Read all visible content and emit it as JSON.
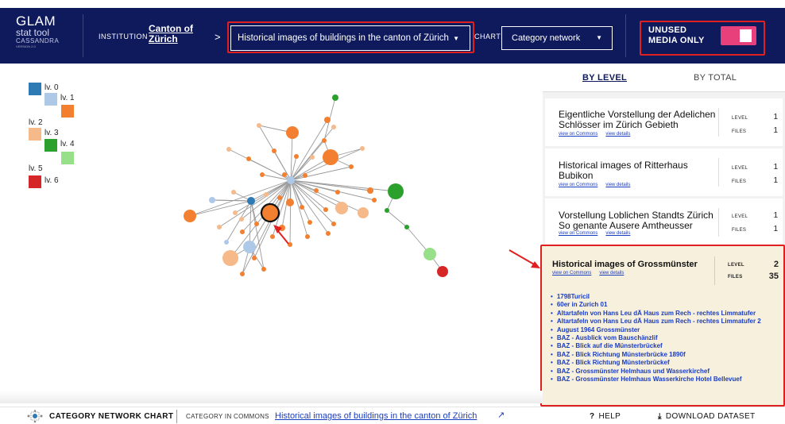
{
  "header": {
    "logo": {
      "line1": "GLAM",
      "line2": "stat tool",
      "line3": "CASSANDRA",
      "line4": "VERSION 2.0"
    },
    "institution_label": "INSTITUTION",
    "institution_value": "Canton of Zürich",
    "separator": ">",
    "dataset_selected": "Historical images of buildings in the canton of Zürich",
    "chart_label": "CHART",
    "chart_selected": "Category network",
    "unused_label_line1": "UNUSED",
    "unused_label_line2": "MEDIA ONLY",
    "unused_enabled": true,
    "colors": {
      "bg": "#0f1a5c",
      "toggle": "#e8407a",
      "highlight": "#e02020"
    }
  },
  "legend": [
    {
      "label": "lv. 0",
      "color": "#2e7ab5"
    },
    {
      "label": "lv. 1",
      "color": "#aec8e8"
    },
    {
      "label": "lv. 2",
      "color": "#f28030"
    },
    {
      "label": "lv. 3",
      "color": "#f5b98a"
    },
    {
      "label": "lv. 4",
      "color": "#2ca02c"
    },
    {
      "label": "lv. 5",
      "color": "#98df8a"
    },
    {
      "label": "lv. 6",
      "color": "#d62728"
    }
  ],
  "panel": {
    "tabs": [
      {
        "label": "BY LEVEL",
        "active": true
      },
      {
        "label": "BY TOTAL",
        "active": false
      }
    ],
    "view_commons": "view on Commons",
    "view_details": "view details",
    "level_label": "LEVEL",
    "files_label": "FILES",
    "cards": [
      {
        "title": "Eigentliche Vorstellung der Adelichen Schlösser im Zürich Gebieth",
        "level": "1",
        "files": "1"
      },
      {
        "title": "Historical images of Ritterhaus Bubikon",
        "level": "1",
        "files": "1"
      },
      {
        "title": "Vorstellung Loblichen Standts Zürich So genante Ausere Amtheusser",
        "level": "1",
        "files": "1"
      }
    ],
    "highlighted": {
      "title": "Historical images of Grossmünster",
      "level": "2",
      "files": "35",
      "items": [
        "1798TuriciI",
        "60er in Zurich 01",
        "Altartafeln von Hans Leu dÄ Haus zum Rech - rechtes Limmatufer",
        "Altartafeln von Hans Leu dÄ Haus zum Rech - rechtes Limmatufer 2",
        "August 1964 Grossmünster",
        "BAZ - Ausblick vom Bauschänzlif",
        "BAZ - Blick auf die Münsterbrückef",
        "BAZ - Blick Richtung Münsterbrücke 1890f",
        "BAZ - Blick Richtung Münsterbrückef",
        "BAZ - Grossmünster Helmhaus und Wasserkirchef",
        "BAZ - Grossmünster Helmhaus Wasserkirche Hotel Bellevuef"
      ]
    }
  },
  "footer": {
    "title": "CATEGORY NETWORK CHART",
    "category_label": "CATEGORY IN COMMONS",
    "category_link": "Historical images of buildings in the canton of Zürich",
    "help": "HELP",
    "download": "DOWNLOAD DATASET"
  }
}
